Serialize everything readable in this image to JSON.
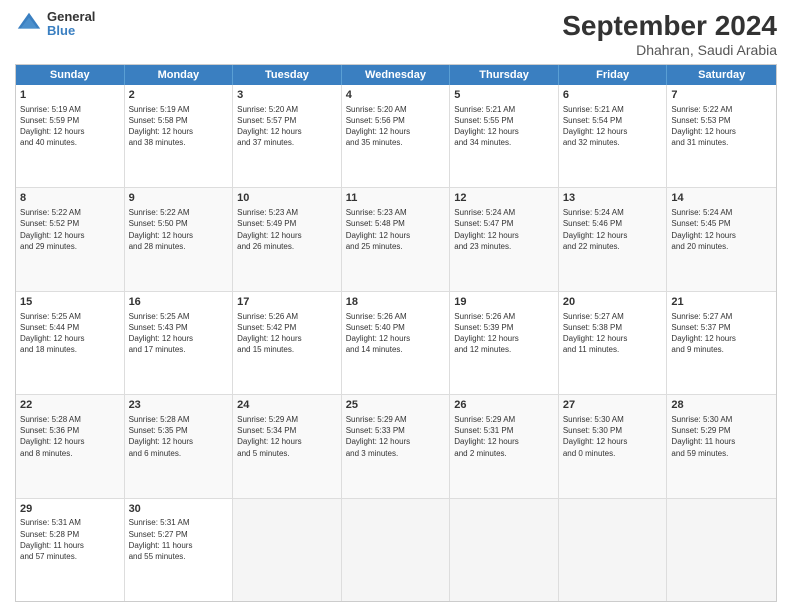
{
  "header": {
    "logo_general": "General",
    "logo_blue": "Blue",
    "month": "September 2024",
    "location": "Dhahran, Saudi Arabia"
  },
  "weekdays": [
    "Sunday",
    "Monday",
    "Tuesday",
    "Wednesday",
    "Thursday",
    "Friday",
    "Saturday"
  ],
  "rows": [
    [
      {
        "day": "",
        "empty": true
      },
      {
        "day": "2",
        "rise": "5:19 AM",
        "set": "5:58 PM",
        "daylight": "12 hours and 38 minutes."
      },
      {
        "day": "3",
        "rise": "5:20 AM",
        "set": "5:57 PM",
        "daylight": "12 hours and 37 minutes."
      },
      {
        "day": "4",
        "rise": "5:20 AM",
        "set": "5:56 PM",
        "daylight": "12 hours and 35 minutes."
      },
      {
        "day": "5",
        "rise": "5:21 AM",
        "set": "5:55 PM",
        "daylight": "12 hours and 34 minutes."
      },
      {
        "day": "6",
        "rise": "5:21 AM",
        "set": "5:54 PM",
        "daylight": "12 hours and 32 minutes."
      },
      {
        "day": "7",
        "rise": "5:22 AM",
        "set": "5:53 PM",
        "daylight": "12 hours and 31 minutes."
      }
    ],
    [
      {
        "day": "1",
        "rise": "5:19 AM",
        "set": "5:59 PM",
        "daylight": "12 hours and 40 minutes.",
        "first": true
      },
      {
        "day": "8",
        "rise": "5:22 AM",
        "set": "5:52 PM",
        "daylight": "12 hours and 29 minutes."
      },
      {
        "day": "9",
        "rise": "5:22 AM",
        "set": "5:50 PM",
        "daylight": "12 hours and 28 minutes."
      },
      {
        "day": "10",
        "rise": "5:23 AM",
        "set": "5:49 PM",
        "daylight": "12 hours and 26 minutes."
      },
      {
        "day": "11",
        "rise": "5:23 AM",
        "set": "5:48 PM",
        "daylight": "12 hours and 25 minutes."
      },
      {
        "day": "12",
        "rise": "5:24 AM",
        "set": "5:47 PM",
        "daylight": "12 hours and 23 minutes."
      },
      {
        "day": "13",
        "rise": "5:24 AM",
        "set": "5:46 PM",
        "daylight": "12 hours and 22 minutes."
      }
    ],
    [
      {
        "day": "14",
        "rise": "5:24 AM",
        "set": "5:45 PM",
        "daylight": "12 hours and 20 minutes."
      },
      {
        "day": "15",
        "rise": "5:25 AM",
        "set": "5:44 PM",
        "daylight": "12 hours and 18 minutes."
      },
      {
        "day": "16",
        "rise": "5:25 AM",
        "set": "5:43 PM",
        "daylight": "12 hours and 17 minutes."
      },
      {
        "day": "17",
        "rise": "5:26 AM",
        "set": "5:42 PM",
        "daylight": "12 hours and 15 minutes."
      },
      {
        "day": "18",
        "rise": "5:26 AM",
        "set": "5:40 PM",
        "daylight": "12 hours and 14 minutes."
      },
      {
        "day": "19",
        "rise": "5:26 AM",
        "set": "5:39 PM",
        "daylight": "12 hours and 12 minutes."
      },
      {
        "day": "20",
        "rise": "5:27 AM",
        "set": "5:38 PM",
        "daylight": "12 hours and 11 minutes."
      }
    ],
    [
      {
        "day": "21",
        "rise": "5:27 AM",
        "set": "5:37 PM",
        "daylight": "12 hours and 9 minutes."
      },
      {
        "day": "22",
        "rise": "5:28 AM",
        "set": "5:36 PM",
        "daylight": "12 hours and 8 minutes."
      },
      {
        "day": "23",
        "rise": "5:28 AM",
        "set": "5:35 PM",
        "daylight": "12 hours and 6 minutes."
      },
      {
        "day": "24",
        "rise": "5:29 AM",
        "set": "5:34 PM",
        "daylight": "12 hours and 5 minutes."
      },
      {
        "day": "25",
        "rise": "5:29 AM",
        "set": "5:33 PM",
        "daylight": "12 hours and 3 minutes."
      },
      {
        "day": "26",
        "rise": "5:29 AM",
        "set": "5:31 PM",
        "daylight": "12 hours and 2 minutes."
      },
      {
        "day": "27",
        "rise": "5:30 AM",
        "set": "5:30 PM",
        "daylight": "12 hours and 0 minutes."
      }
    ],
    [
      {
        "day": "28",
        "rise": "5:30 AM",
        "set": "5:29 PM",
        "daylight": "11 hours and 59 minutes."
      },
      {
        "day": "29",
        "rise": "5:31 AM",
        "set": "5:28 PM",
        "daylight": "11 hours and 57 minutes."
      },
      {
        "day": "30",
        "rise": "5:31 AM",
        "set": "5:27 PM",
        "daylight": "11 hours and 55 minutes."
      },
      {
        "day": "",
        "empty": true
      },
      {
        "day": "",
        "empty": true
      },
      {
        "day": "",
        "empty": true
      },
      {
        "day": "",
        "empty": true
      }
    ]
  ]
}
